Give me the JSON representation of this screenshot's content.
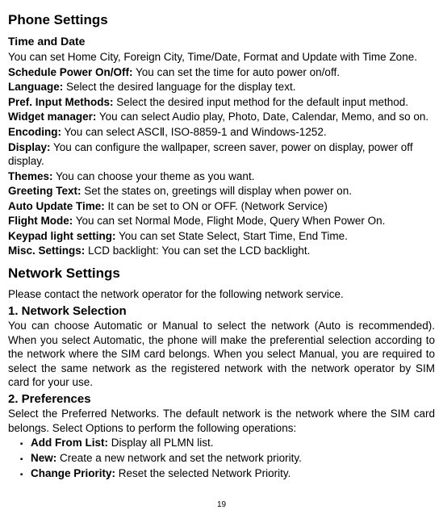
{
  "title": "Phone Settings",
  "timeDate": {
    "heading": "Time and Date",
    "text": "You can set Home City, Foreign City, Time/Date, Format and Update with Time Zone."
  },
  "lines": [
    {
      "label": "Schedule Power On/Off:",
      "text": " You can set the time for auto power on/off."
    },
    {
      "label": "Language:",
      "text": " Select the desired language for the display text."
    },
    {
      "label": "Pref. Input Methods:",
      "text": " Select the desired input method for the default input method."
    },
    {
      "label": "Widget manager:",
      "text": " You can select Audio play, Photo, Date, Calendar, Memo, and so on."
    },
    {
      "label": "Encoding:",
      "text": " You can select ASCⅡ, ISO-8859-1 and Windows-1252."
    },
    {
      "label": "Display:",
      "text": " You can configure the wallpaper, screen saver, power on display, power off display."
    },
    {
      "label": "Themes:",
      "text": " You can choose your theme as you want."
    },
    {
      "label": "Greeting Text:",
      "text": " Set the states on, greetings will display when power on."
    },
    {
      "label": "Auto Update Time:",
      "text": " It can be set to ON or OFF. (Network Service)"
    },
    {
      "label": "Flight Mode:",
      "text": " You can set Normal Mode, Flight Mode, Query When Power On."
    },
    {
      "label": "Keypad light setting:",
      "text": " You can set State Select, Start Time, End Time."
    },
    {
      "label": "Misc. Settings:",
      "text": " LCD backlight: You can set the LCD backlight."
    }
  ],
  "network": {
    "heading": "Network Settings",
    "intro": "Please contact the network operator for the following network service.",
    "sec1": {
      "heading": "1. Network Selection",
      "text": "You can choose Automatic or Manual to select the network (Auto is recommended). When you select Automatic, the phone will make the preferential selection according to the network where the SIM card belongs. When you select Manual, you are required to select the same network as the registered network with the network operator by SIM card for your use."
    },
    "sec2": {
      "heading": "2. Preferences",
      "text": "Select the Preferred Networks. The default network is the network where the SIM card belongs. Select Options to perform the following operations:",
      "bullets": [
        {
          "label": "Add From List:",
          "text": " Display all PLMN list."
        },
        {
          "label": "New:",
          "text": " Create a new network and set the network priority."
        },
        {
          "label": "Change Priority:",
          "text": " Reset the selected Network Priority."
        }
      ]
    }
  },
  "pageNumber": "19"
}
